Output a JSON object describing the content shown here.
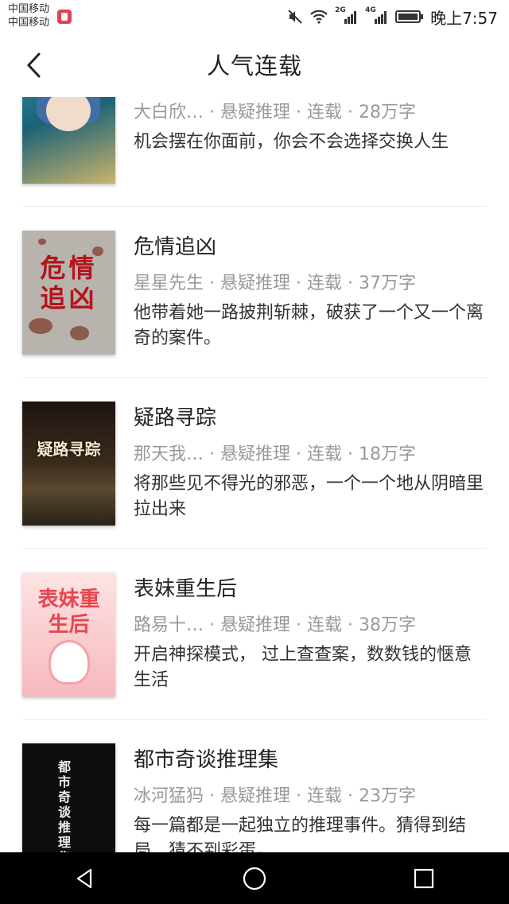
{
  "status_bar": {
    "carrier_line1": "中国移动",
    "carrier_line2": "中国移动",
    "net1": "2G",
    "net2": "4G",
    "time": "晚上7:57"
  },
  "header": {
    "title": "人气连载"
  },
  "books": [
    {
      "title": "",
      "author": "大白欣…",
      "genre": "悬疑推理",
      "status": "连载",
      "words": "28万字",
      "description": "机会摆在你面前，你会不会选择交换人生",
      "cover_text": ""
    },
    {
      "title": "危情追凶",
      "author": "星星先生",
      "genre": "悬疑推理",
      "status": "连载",
      "words": "37万字",
      "description": "他带着她一路披荆斩棘，破获了一个又一个离奇的案件。",
      "cover_text": "危情追凶"
    },
    {
      "title": "疑路寻踪",
      "author": "那天我…",
      "genre": "悬疑推理",
      "status": "连载",
      "words": "18万字",
      "description": "将那些见不得光的邪恶，一个一个地从阴暗里拉出来",
      "cover_text": "疑路寻踪"
    },
    {
      "title": "表妹重生后",
      "author": "路易十…",
      "genre": "悬疑推理",
      "status": "连载",
      "words": "38万字",
      "description": "开启神探模式， 过上查查案，数数钱的惬意生活",
      "cover_text": "表妹重生后"
    },
    {
      "title": "都市奇谈推理集",
      "author": "冰河猛犸",
      "genre": "悬疑推理",
      "status": "连载",
      "words": "23万字",
      "description": "每一篇都是一起独立的推理事件。猜得到结局，猜不到彩蛋。",
      "cover_text": "都市奇谈推理集"
    }
  ],
  "meta_separator": " · ",
  "colors": {
    "title_text": "#222222",
    "meta_text": "#999999",
    "divider": "#ebebeb",
    "nav_bar": "#000000"
  },
  "icons": {
    "back": "chevron-left-icon",
    "nav_back": "triangle-back-icon",
    "nav_home": "circle-home-icon",
    "nav_recent": "square-recents-icon"
  }
}
